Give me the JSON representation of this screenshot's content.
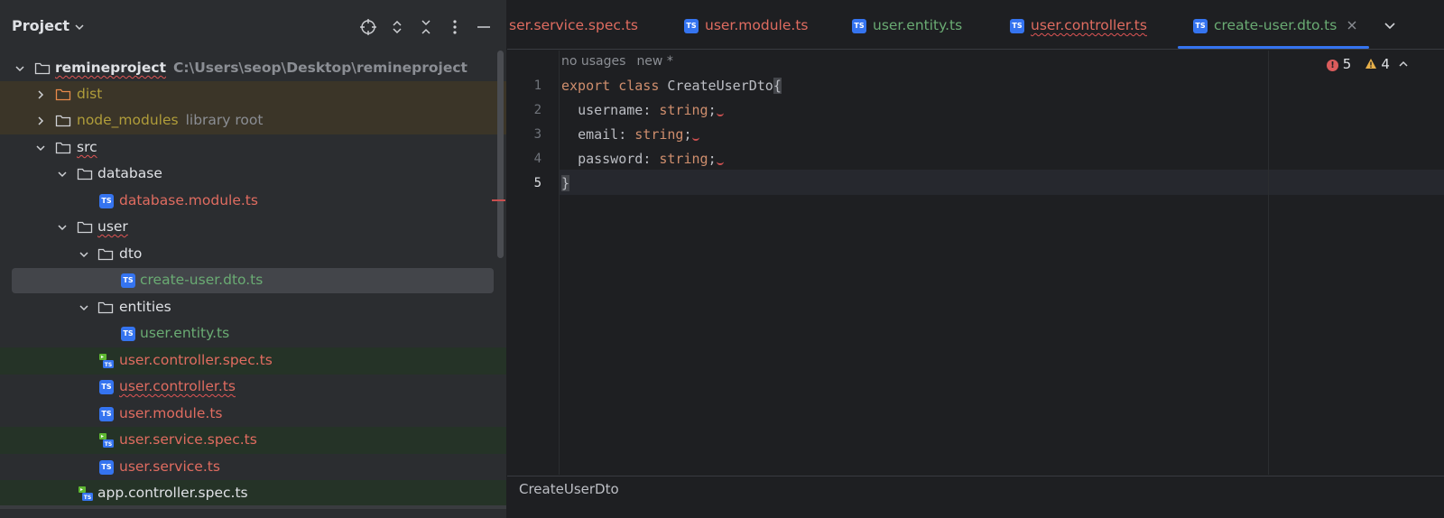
{
  "panel": {
    "title": "Project",
    "header_icons": [
      "crosshair-icon",
      "expand-all-icon",
      "collapse-all-icon",
      "more-options-icon",
      "minimize-icon"
    ]
  },
  "tree": {
    "root": {
      "name": "remineproject",
      "path": "C:\\Users\\seop\\Desktop\\remineproject"
    },
    "items": [
      {
        "label": "dist"
      },
      {
        "label": "node_modules",
        "sub": "library root"
      },
      {
        "label": "src"
      },
      {
        "label": "database"
      },
      {
        "label": "database.module.ts"
      },
      {
        "label": "user"
      },
      {
        "label": "dto"
      },
      {
        "label": "create-user.dto.ts"
      },
      {
        "label": "entities"
      },
      {
        "label": "user.entity.ts"
      },
      {
        "label": "user.controller.spec.ts"
      },
      {
        "label": "user.controller.ts"
      },
      {
        "label": "user.module.ts"
      },
      {
        "label": "user.service.spec.ts"
      },
      {
        "label": "user.service.ts"
      },
      {
        "label": "app.controller.spec.ts"
      }
    ]
  },
  "tabs": [
    {
      "label": "ser.service.spec.ts"
    },
    {
      "label": "user.module.ts"
    },
    {
      "label": "user.entity.ts"
    },
    {
      "label": "user.controller.ts"
    },
    {
      "label": "create-user.dto.ts"
    }
  ],
  "ts_badge": "TS",
  "editor": {
    "inlay_usages": "no usages",
    "inlay_new": "new *",
    "line_numbers": [
      "1",
      "2",
      "3",
      "4",
      "5"
    ],
    "code": {
      "l1_kw1": "export",
      "l1_kw2": "class",
      "l1_name": "CreateUserDto",
      "l1_brace": "{",
      "l2_prop": "username",
      "l3_prop": "email",
      "l4_prop": "password",
      "colon": ":",
      "type": "string",
      "semi": ";",
      "l5_brace": "}"
    },
    "errors": "5",
    "warnings": "4",
    "breadcrumb": "CreateUserDto"
  },
  "colors": {
    "accent": "#3574f0",
    "error": "#db5c5c",
    "warning": "#e8b04a",
    "modified_green": "#6aab73",
    "unversioned_red": "#e06c60",
    "excluded_olive": "#b09d3a"
  }
}
